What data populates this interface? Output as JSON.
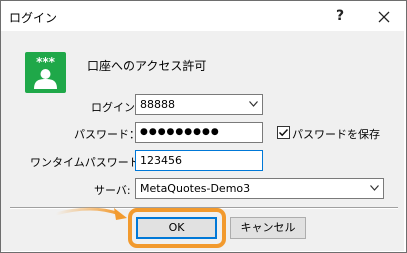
{
  "window": {
    "title": "ログイン",
    "help_glyph": "?",
    "close_glyph": "✕"
  },
  "header": {
    "icon_glyph": "***",
    "text": "口座へのアクセス許可"
  },
  "form": {
    "login_label": "ログイン:",
    "login_value": "88888",
    "password_label": "パスワード：",
    "password_value": "●●●●●●●●●",
    "save_password_label": "パスワードを保存",
    "save_password_checked": true,
    "otp_label": "ワンタイムパスワード:",
    "otp_value": "123456",
    "server_label": "サーバ:",
    "server_value": "MetaQuotes-Demo3"
  },
  "buttons": {
    "ok_label": "OK",
    "cancel_label": "キャンセル"
  },
  "colors": {
    "accent": "#0078d7",
    "icon_green": "#1fa849",
    "highlight_orange": "#f29a2e"
  }
}
